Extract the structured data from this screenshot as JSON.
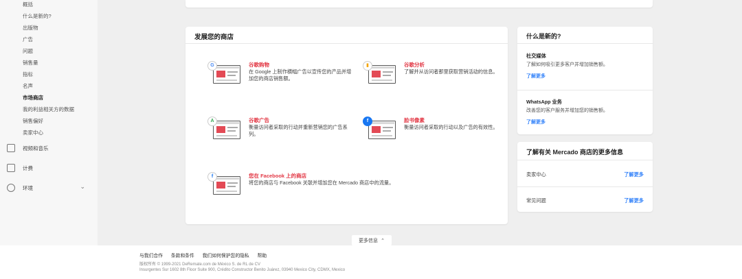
{
  "sidebar": {
    "links": [
      "概括",
      "什么是新的?",
      "出版物",
      "广告",
      "问题",
      "销售量",
      "指标",
      "名声",
      "市场商店",
      "我的利益相关方的数据",
      "销售偏好",
      "卖家中心"
    ],
    "active_index": 8,
    "sections": [
      {
        "label": "视频和音乐",
        "icon": "video-music-icon"
      },
      {
        "label": "计费",
        "icon": "document-icon"
      },
      {
        "label": "环境",
        "icon": "gear-icon"
      }
    ]
  },
  "main": {
    "title": "发展您的商店",
    "features": [
      {
        "name": "谷歌购物",
        "desc": "在 Google 上制作横幅广告以宣传您的产品并增加您的商店销售额。",
        "badge": "G",
        "icon": "google-shopping-icon"
      },
      {
        "name": "谷歌分析",
        "desc": "了解并从访问者那里获取营销活动的信息。",
        "badge": "▮",
        "icon": "google-analytics-icon"
      },
      {
        "name": "谷歌广告",
        "desc": "衡量访问者采取的行动并重新营销您的广告系列。",
        "badge": "A",
        "icon": "google-ads-icon"
      },
      {
        "name": "脸书像素",
        "desc": "衡量访问者采取的行动以及广告的有效性。",
        "badge": "f",
        "icon": "facebook-pixel-icon"
      },
      {
        "name": "您在 Facebook 上的商店",
        "desc": "将您的商店与 Facebook 关联并增加您在 Mercado 商店中的流量。",
        "badge": "f",
        "icon": "facebook-shop-icon"
      }
    ]
  },
  "news": {
    "title": "什么是新的?",
    "items": [
      {
        "title": "社交媒体",
        "desc": "了解如何吸引更多客户并增加销售额。",
        "link": "了解更多"
      },
      {
        "title": "WhatsApp 业务",
        "desc": "改善您的客户服务并增加您的销售额。",
        "link": "了解更多"
      }
    ]
  },
  "more": {
    "title": "了解有关 Mercado 商店的更多信息",
    "rows": [
      {
        "label": "卖家中心",
        "link": "了解更多"
      },
      {
        "label": "常见问题",
        "link": "了解更多"
      }
    ]
  },
  "more_info_button": "更多信息",
  "footer": {
    "links": [
      "与我们合作",
      "条款和条件",
      "我们如何保护您的隐私",
      "帮助"
    ],
    "copyright": "版权所有 © 1999-2021 DeRemate.com de México S. de RL de CV",
    "address": "Insurgentes Sur 1602 8th Floor Suite 900, Crédito Constructor Benito Juárez, 03940 Mexico City, CDMX, Mexico"
  },
  "colors": {
    "accent_red": "#e23744",
    "link_blue": "#3483fa"
  }
}
